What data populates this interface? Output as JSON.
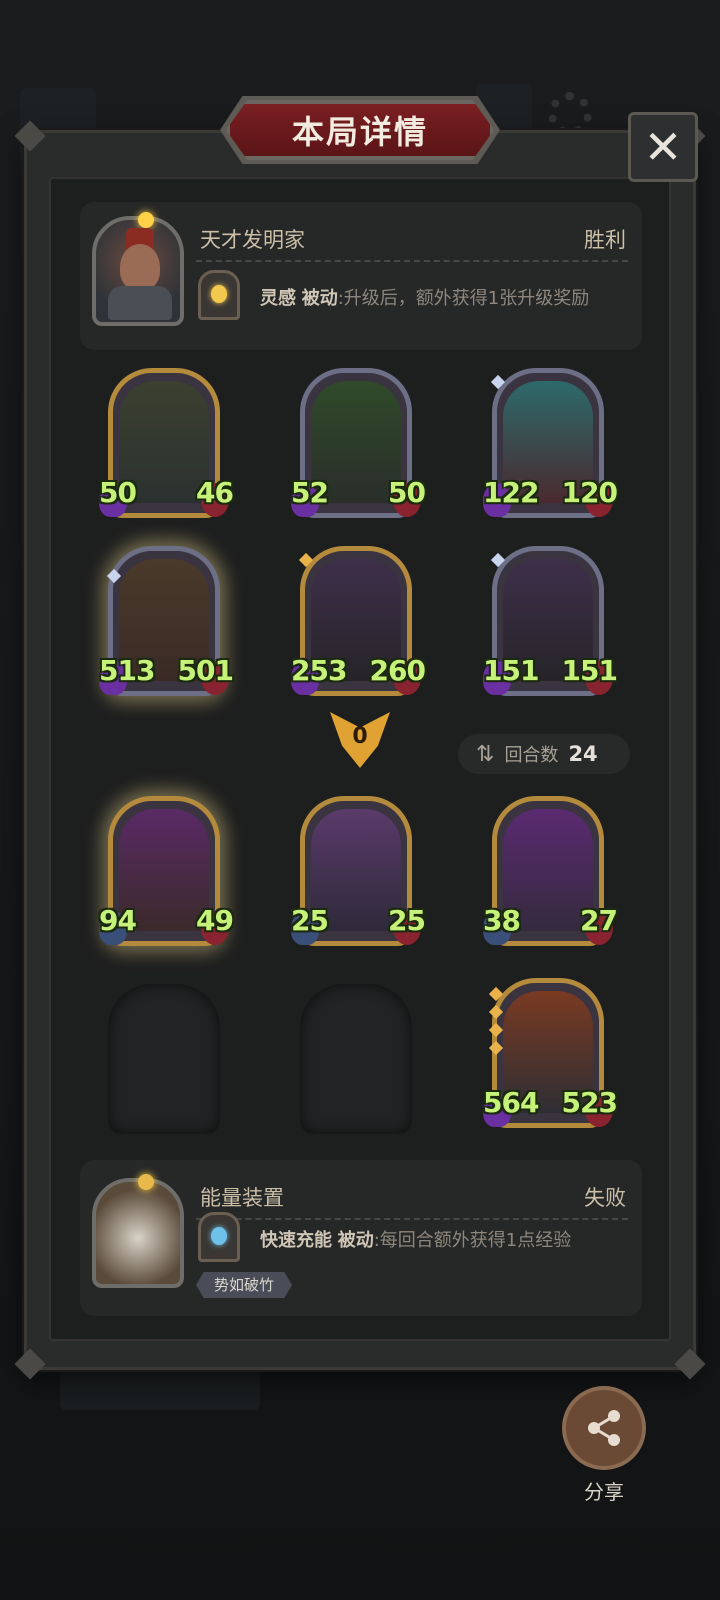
{
  "dialog": {
    "title": "本局详情",
    "close_label": "✕"
  },
  "player": {
    "name": "天才发明家",
    "result": "胜利",
    "skill_name": "灵感",
    "skill_type": "被动",
    "skill_desc": ":升级后，额外获得1张升级奖励"
  },
  "player_units": [
    {
      "attack": "50",
      "health": "46"
    },
    {
      "attack": "52",
      "health": "50"
    },
    {
      "attack": "122",
      "health": "120"
    },
    {
      "attack": "513",
      "health": "501"
    },
    {
      "attack": "253",
      "health": "260"
    },
    {
      "attack": "151",
      "health": "151"
    }
  ],
  "middle": {
    "damage_value": "0",
    "round_label": "回合数",
    "round_value": "24"
  },
  "opponent_units": [
    {
      "attack": "94",
      "health": "49"
    },
    {
      "attack": "25",
      "health": "25"
    },
    {
      "attack": "38",
      "health": "27"
    },
    {
      "attack": "564",
      "health": "523"
    }
  ],
  "opponent": {
    "name": "能量装置",
    "result": "失败",
    "skill_name": "快速充能",
    "skill_type": "被动",
    "skill_desc": ":每回合额外获得1点经验",
    "badge": "势如破竹"
  },
  "share": {
    "label": "分享"
  }
}
